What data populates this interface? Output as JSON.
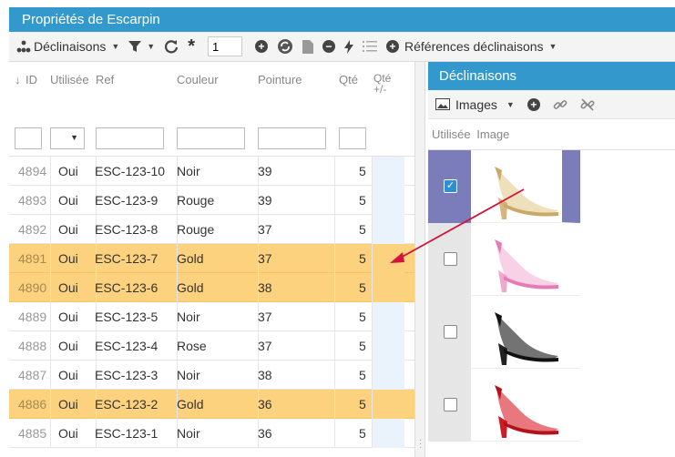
{
  "window_title": "Propriétés de Escarpin",
  "toolbar": {
    "declinaisons_label": "Déclinaisons",
    "page_value": "1",
    "references_label": "Références déclinaisons"
  },
  "grid": {
    "headers": {
      "id": "ID",
      "used": "Utilisée",
      "ref": "Ref",
      "color": "Couleur",
      "size": "Pointure",
      "qty": "Qté",
      "qty_delta": "Qté +/-"
    },
    "rows": [
      {
        "id": "4894",
        "used": "Oui",
        "ref": "ESC-123-10",
        "color": "Noir",
        "size": "39",
        "qty": "5",
        "selected": false
      },
      {
        "id": "4893",
        "used": "Oui",
        "ref": "ESC-123-9",
        "color": "Rouge",
        "size": "39",
        "qty": "5",
        "selected": false
      },
      {
        "id": "4892",
        "used": "Oui",
        "ref": "ESC-123-8",
        "color": "Rouge",
        "size": "37",
        "qty": "5",
        "selected": false
      },
      {
        "id": "4891",
        "used": "Oui",
        "ref": "ESC-123-7",
        "color": "Gold",
        "size": "37",
        "qty": "5",
        "selected": true
      },
      {
        "id": "4890",
        "used": "Oui",
        "ref": "ESC-123-6",
        "color": "Gold",
        "size": "38",
        "qty": "5",
        "selected": true
      },
      {
        "id": "4889",
        "used": "Oui",
        "ref": "ESC-123-5",
        "color": "Noir",
        "size": "37",
        "qty": "5",
        "selected": false
      },
      {
        "id": "4888",
        "used": "Oui",
        "ref": "ESC-123-4",
        "color": "Rose",
        "size": "37",
        "qty": "5",
        "selected": false
      },
      {
        "id": "4887",
        "used": "Oui",
        "ref": "ESC-123-3",
        "color": "Noir",
        "size": "38",
        "qty": "5",
        "selected": false
      },
      {
        "id": "4886",
        "used": "Oui",
        "ref": "ESC-123-2",
        "color": "Gold",
        "size": "36",
        "qty": "5",
        "selected": true
      },
      {
        "id": "4885",
        "used": "Oui",
        "ref": "ESC-123-1",
        "color": "Noir",
        "size": "36",
        "qty": "5",
        "selected": false
      }
    ]
  },
  "declinaisons_panel": {
    "title": "Déclinaisons",
    "images_label": "Images",
    "col_used": "Utilisée",
    "col_image": "Image",
    "images": [
      {
        "shoe": "gold-shoe",
        "checked": true
      },
      {
        "shoe": "pink-shoe",
        "checked": false
      },
      {
        "shoe": "black-shoe",
        "checked": false
      },
      {
        "shoe": "red-shoe",
        "checked": false
      }
    ]
  },
  "colors": {
    "header_blue": "#3399cc",
    "selected_row": "#fdd27e",
    "selected_image": "#7b7dba",
    "arrow": "#d0143c"
  }
}
